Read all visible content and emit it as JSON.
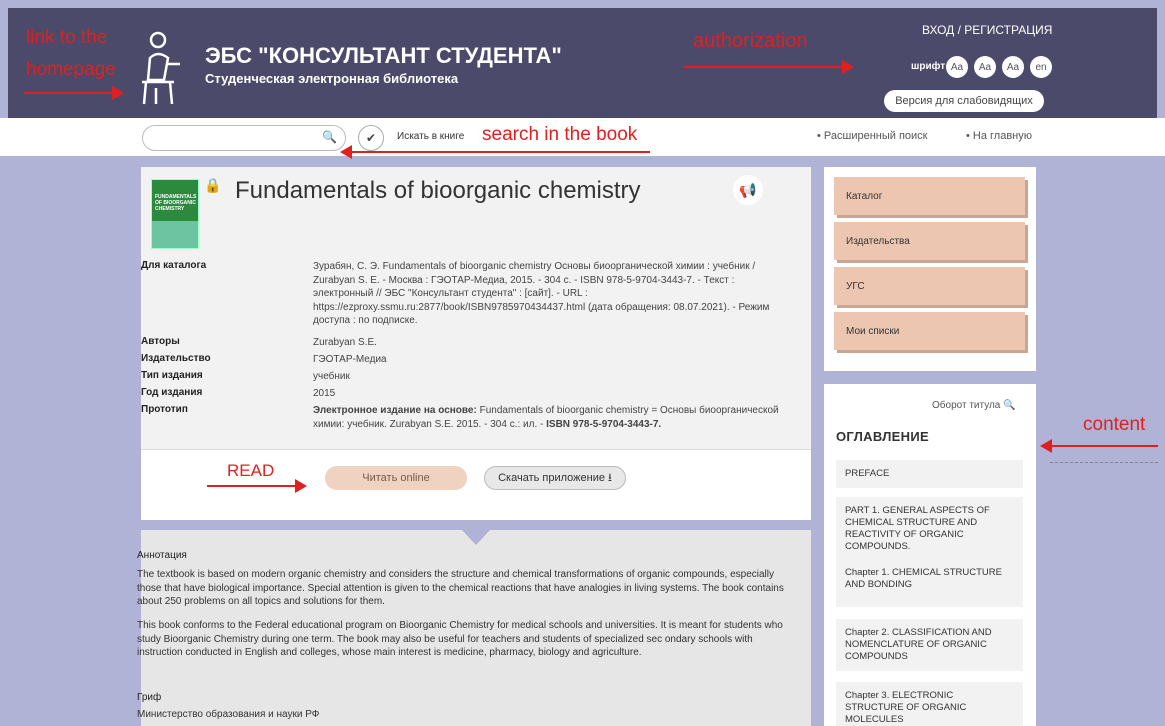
{
  "header": {
    "title": "ЭБС \"КОНСУЛЬТАНТ СТУДЕНТА\"",
    "subtitle": "Студенческая электронная библиотека",
    "login": "ВХОД / РЕГИСТРАЦИЯ",
    "font_label": "шрифт",
    "font_buttons": [
      "Aa",
      "Aa",
      "Aa",
      "en"
    ],
    "vision_version": "Версия для слабовидящих"
  },
  "search": {
    "placeholder": "",
    "search_in_book": "Искать в книге",
    "advanced": "• Расширенный поиск",
    "home": "• На главную"
  },
  "book": {
    "title": "Fundamentals of bioorganic chemistry",
    "cover_text": "FUNDAMENTALS OF BIOORGANIC CHEMISTRY",
    "meta": [
      {
        "label": "Для каталога",
        "value": "Зурабян, С. Э. Fundamentals of bioorganic chemistry Основы биоорганической химии : учебник / Zurabyan S. E. - Москва : ГЭОТАР-Медиа, 2015. - 304 с. - ISBN 978-5-9704-3443-7. - Текст : электронный // ЭБС \"Консультант студента\" : [сайт]. - URL : https://ezproxy.ssmu.ru:2877/book/ISBN9785970434437.html (дата обращения: 08.07.2021). - Режим доступа : по подписке."
      },
      {
        "label": "Авторы",
        "value": "Zurabyan S.E."
      },
      {
        "label": "Издательство",
        "value": "ГЭОТАР-Медиа"
      },
      {
        "label": "Тип издания",
        "value": "учебник"
      },
      {
        "label": "Год издания",
        "value": "2015"
      },
      {
        "label": "Прототип",
        "value_bold": "Электронное издание на основе:",
        "value": " Fundamentals of bioorganic chemistry = Основы биоорганической химии: учебник. Zurabyan S.E. 2015. - 304 с.: ил. - ",
        "isbn": "ISBN 978-5-9704-3443-7."
      }
    ],
    "read_label": "Читать online",
    "download_label": "Скачать приложение"
  },
  "abstract": {
    "label": "Аннотация",
    "p1": "The textbook is based on modern organic chemistry and considers the structure and chemical transformations of organic compounds, especially those that have biological importance. Special attention is given to the chemical reactions that have analogies in living systems. The book contains about 250 problems on all topics and solutions for them.",
    "p2": "This book conforms to the Federal educational program on Bioorganic Chemistry for medical schools and universities. It is meant for students who study Bioorganic Chemistry during one term. The book may also be useful for teachers and students of specialized sec ondary schools with instruction conducted in English and colleges, whose main interest is medicine, pharmacy, biology and agriculture.",
    "grif_label": "Гриф",
    "grif_value": "Министерство образования и науки РФ"
  },
  "catalog_menu": [
    "Каталог",
    "Издательства",
    "УГС",
    "Мои списки"
  ],
  "toc": {
    "title_page": "Оборот титула",
    "title": "ОГЛАВЛЕНИЕ",
    "items": [
      "PREFACE",
      "PART 1. GENERAL ASPECTS OF CHEMICAL STRUCTURE AND REACTIVITY OF ORGANIC COMPOUNDS.",
      "Chapter 1. CHEMICAL STRUCTURE AND BONDING",
      "Chapter 2. CLASSIFICATION AND NOMENCLATURE OF ORGANIC COMPOUNDS",
      "Chapter 3. ELECTRONIC STRUCTURE OF ORGANIC MOLECULES"
    ]
  },
  "annotations": {
    "homepage": "link to the homepage",
    "authorization": "authorization",
    "search": "search in the book",
    "read": "READ",
    "content": "content"
  },
  "colors": {
    "header_bg": "#4b4a6b",
    "page_bg": "#b0b3d6",
    "accent": "#f0d2c0",
    "annotation": "#e02020"
  }
}
